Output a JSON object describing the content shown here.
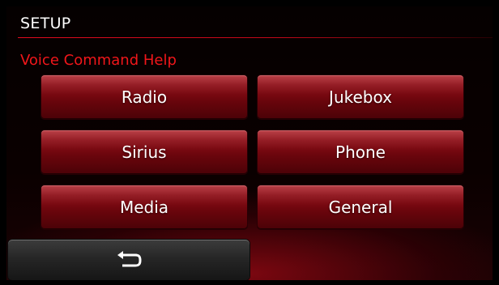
{
  "header": {
    "title": "SETUP",
    "subtitle": "Voice Command Help"
  },
  "buttons": [
    {
      "label": "Radio"
    },
    {
      "label": "Jukebox"
    },
    {
      "label": "Sirius"
    },
    {
      "label": "Phone"
    },
    {
      "label": "Media"
    },
    {
      "label": "General"
    }
  ],
  "footer": {
    "back_icon": "return-arrow-icon"
  },
  "colors": {
    "accent": "#e10a1e",
    "button": "#8e0f18",
    "back_button": "#262626"
  }
}
